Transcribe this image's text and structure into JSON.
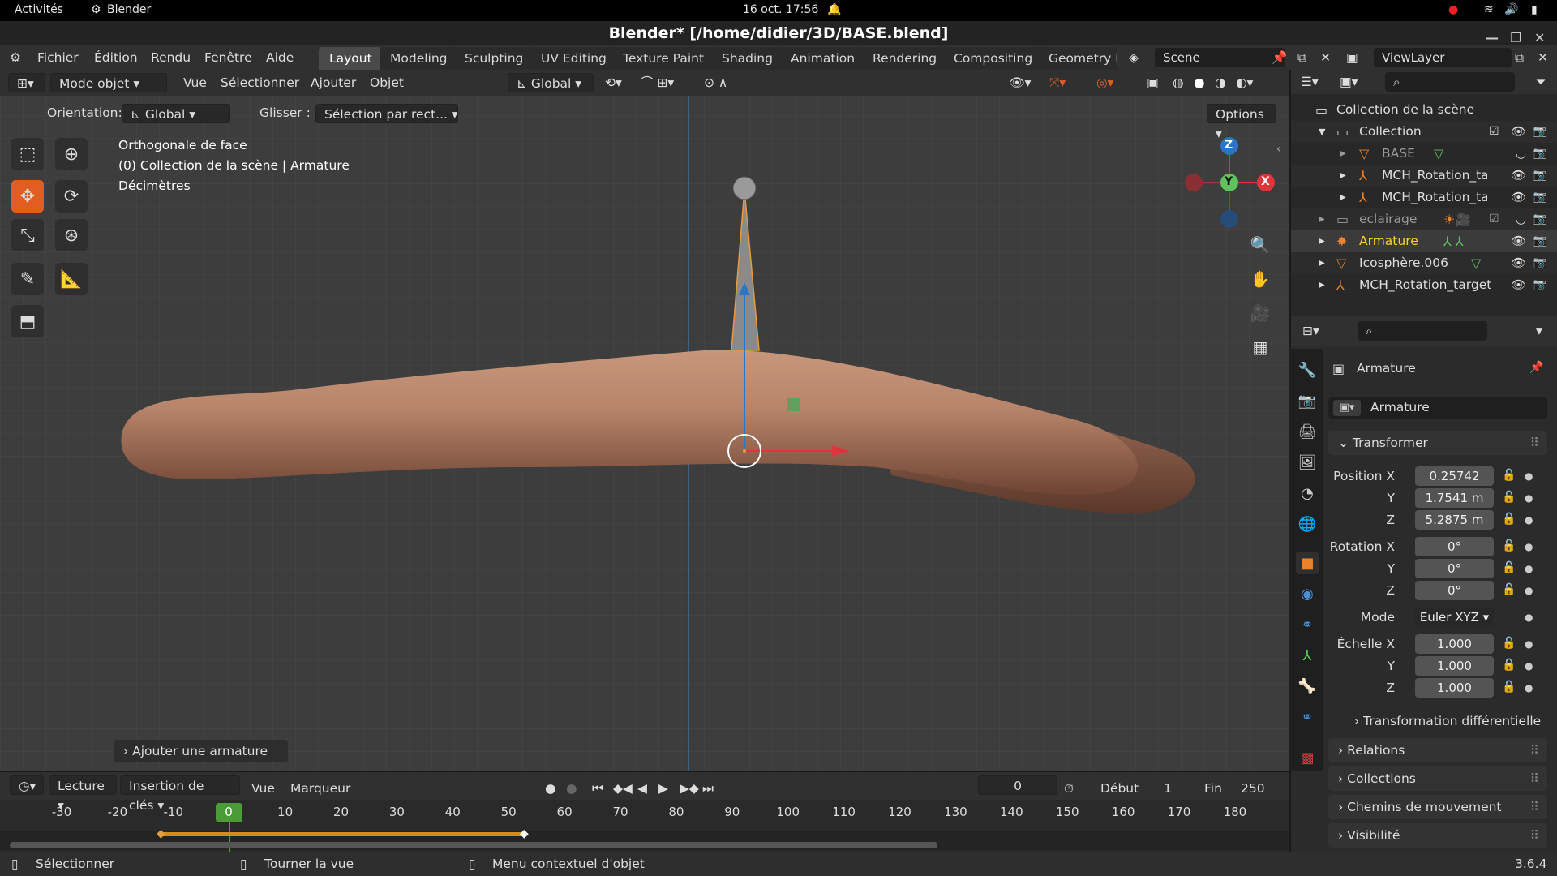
{
  "os": {
    "activities": "Activités",
    "app": "Blender",
    "datetime": "16 oct.  17:56"
  },
  "window": {
    "title": "Blender* [/home/didier/3D/BASE.blend]"
  },
  "menu": {
    "items": [
      "Fichier",
      "Édition",
      "Rendu",
      "Fenêtre",
      "Aide"
    ]
  },
  "workspaces": [
    "Layout",
    "Modeling",
    "Sculpting",
    "UV Editing",
    "Texture Paint",
    "Shading",
    "Animation",
    "Rendering",
    "Compositing",
    "Geometry N"
  ],
  "scene": {
    "name": "Scene",
    "viewlayer": "ViewLayer"
  },
  "viewport_header": {
    "mode": "Mode objet",
    "vue": "Vue",
    "select": "Sélectionner",
    "add": "Ajouter",
    "object": "Objet",
    "transform": "Global"
  },
  "tool_settings": {
    "orientation_label": "Orientation:",
    "orientation": "Global",
    "drag_label": "Glisser :",
    "drag": "Sélection par rect...",
    "options": "Options"
  },
  "viewport_info": {
    "line1": "Orthogonale de face",
    "line2": "(0) Collection de la scène | Armature",
    "line3": "Décimètres"
  },
  "last_op": "Ajouter une armature",
  "gizmo": {
    "z": "Z",
    "y": "Y",
    "x": "X"
  },
  "outliner": {
    "root": "Collection de la scène",
    "rows": [
      {
        "name": "Collection",
        "icon": "collection-icon"
      },
      {
        "name": "BASE",
        "icon": "mesh-icon"
      },
      {
        "name": "MCH_Rotation_ta",
        "icon": "armature-icon"
      },
      {
        "name": "MCH_Rotation_ta",
        "icon": "armature-icon"
      },
      {
        "name": "eclairage",
        "icon": "collection-icon"
      },
      {
        "name": "Armature",
        "icon": "armature-icon"
      },
      {
        "name": "Icosphère.006",
        "icon": "mesh-icon"
      },
      {
        "name": "MCH_Rotation_target",
        "icon": "armature-icon"
      }
    ]
  },
  "properties": {
    "object_name": "Armature",
    "datablock": "Armature",
    "transform_header": "Transformer",
    "position": {
      "label": "Position X",
      "x": "0.25742",
      "y": "1.7541 m",
      "z": "5.2875 m"
    },
    "rotation": {
      "label": "Rotation X",
      "x": "0°",
      "y": "0°",
      "z": "0°"
    },
    "mode_label": "Mode",
    "mode": "Euler XYZ",
    "scale": {
      "label": "Échelle X",
      "x": "1.000",
      "y": "1.000",
      "z": "1.000"
    },
    "axis_y": "Y",
    "axis_z": "Z",
    "delta": "Transformation différentielle",
    "panels": [
      "Relations",
      "Collections",
      "Chemins de mouvement",
      "Visibilité"
    ]
  },
  "timeline": {
    "play": "Lecture",
    "keying": "Insertion de clés",
    "vue": "Vue",
    "marker": "Marqueur",
    "current": "0",
    "start_label": "Début",
    "start": "1",
    "end_label": "Fin",
    "end": "250",
    "ticks": [
      "-30",
      "-20",
      "-10",
      "0",
      "10",
      "20",
      "30",
      "40",
      "50",
      "60",
      "70",
      "80",
      "90",
      "100",
      "110",
      "120",
      "130",
      "140",
      "150",
      "160",
      "170",
      "180"
    ]
  },
  "status": {
    "select": "Sélectionner",
    "rotate": "Tourner la vue",
    "context": "Menu contextuel d'objet",
    "version": "3.6.4"
  },
  "colors": {
    "accent": "#e15e22",
    "selected_text": "#ffd11f",
    "timeline_key": "#d68a1c"
  }
}
